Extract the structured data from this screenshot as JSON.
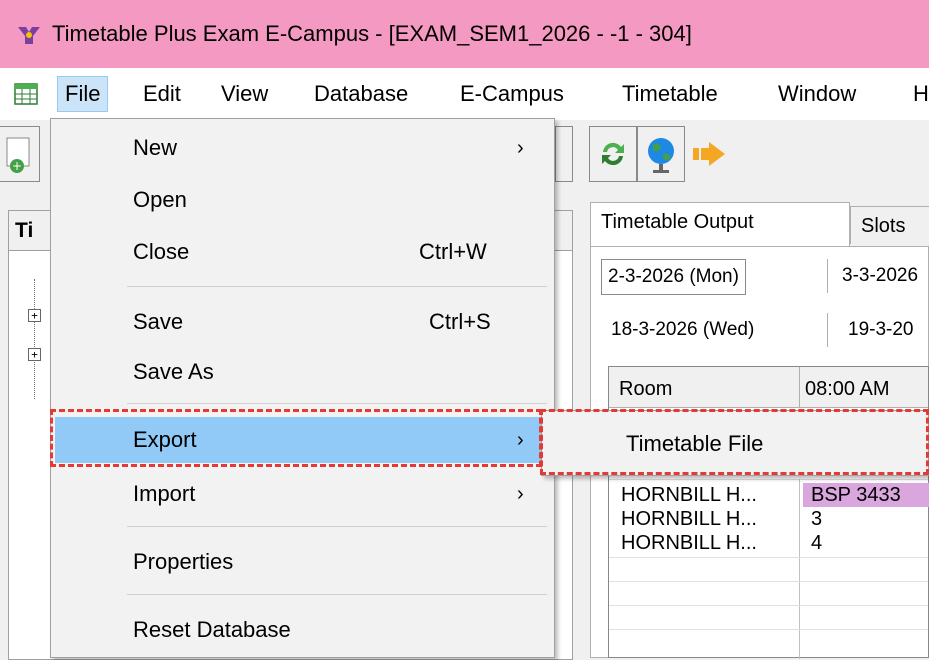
{
  "window": {
    "title": "Timetable Plus Exam E-Campus - [EXAM_SEM1_2026 - -1 - 304]",
    "titlebar_color": "#f49ac2"
  },
  "menubar": {
    "items": [
      "File",
      "Edit",
      "View",
      "Database",
      "E-Campus",
      "Timetable",
      "Window",
      "H"
    ]
  },
  "file_menu": {
    "items": [
      {
        "label": "New",
        "shortcut": "",
        "submenu": true
      },
      {
        "label": "Open",
        "shortcut": ""
      },
      {
        "label": "Close",
        "shortcut": "Ctrl+W"
      },
      {
        "label": "Save",
        "shortcut": "Ctrl+S"
      },
      {
        "label": "Save As",
        "shortcut": ""
      },
      {
        "label": "Export",
        "shortcut": "",
        "submenu": true,
        "highlighted": true
      },
      {
        "label": "Import",
        "shortcut": "",
        "submenu": true
      },
      {
        "label": "Properties",
        "shortcut": ""
      },
      {
        "label": "Reset Database",
        "shortcut": ""
      }
    ],
    "arrow_glyph": "›"
  },
  "export_submenu": {
    "items": [
      {
        "label": "Timetable File"
      }
    ]
  },
  "left_panel": {
    "header": "Ti"
  },
  "right_panel": {
    "tabs": [
      "Timetable Output",
      "Slots"
    ],
    "dates": {
      "row1": [
        "2-3-2026 (Mon)",
        "3-3-2026"
      ],
      "row2": [
        "18-3-2026 (Wed)",
        "19-3-20"
      ]
    },
    "grid": {
      "headers": [
        "Room",
        "08:00 AM"
      ],
      "rows": [
        {
          "room": "HORNBILL H...",
          "value": "BSP 3433"
        },
        {
          "room": "HORNBILL H...",
          "value": "3"
        },
        {
          "room": "HORNBILL H...",
          "value": "4"
        }
      ]
    }
  },
  "colors": {
    "menu_highlight": "#91c9f7",
    "annotation": "#e53935",
    "cell_highlight": "#d9a6de"
  }
}
